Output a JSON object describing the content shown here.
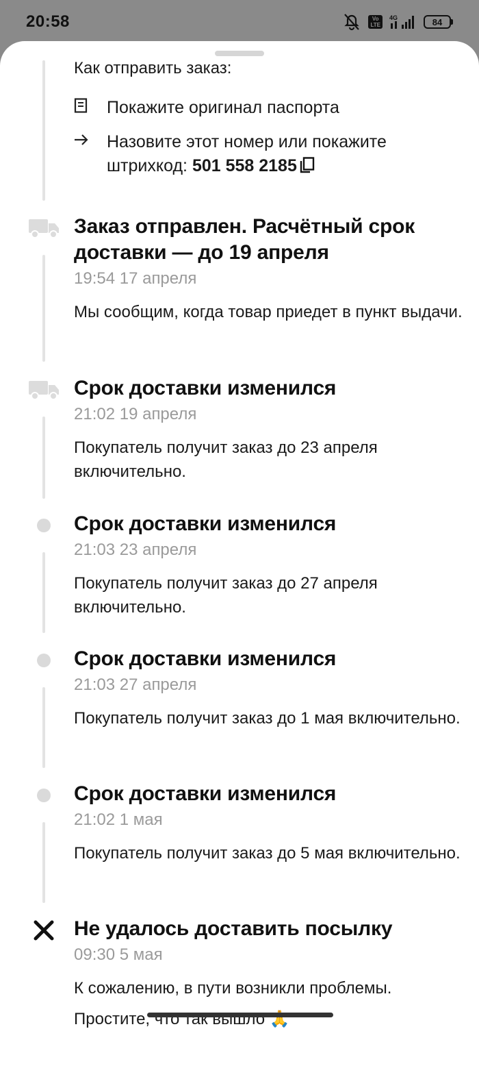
{
  "status_bar": {
    "time": "20:58",
    "battery": "84",
    "network": "4G",
    "volte": "Vo LTE"
  },
  "how_to_send": {
    "title": "Как отправить заказ:",
    "passport": "Покажите оригинал паспорта",
    "name_number_prefix": "Назовите этот номер или покажите штрихкод: ",
    "number": "501 558 2185"
  },
  "events": [
    {
      "title": "Заказ отправлен. Расчётный срок доставки — до 19 апреля",
      "time": "19:54 17 апреля",
      "message": "Мы сообщим, когда товар приедет в пункт выдачи.",
      "icon": "truck-icon"
    },
    {
      "title": "Срок доставки изменился",
      "time": "21:02 19 апреля",
      "message": "Покупатель получит заказ до 23 апреля включительно.",
      "icon": "truck-icon"
    },
    {
      "title": "Срок доставки изменился",
      "time": "21:03 23 апреля",
      "message": "Покупатель получит заказ до 27 апреля включительно.",
      "icon": "dot-icon"
    },
    {
      "title": "Срок доставки изменился",
      "time": "21:03 27 апреля",
      "message": "Покупатель получит заказ до 1 мая включительно.",
      "icon": "dot-icon"
    },
    {
      "title": "Срок доставки изменился",
      "time": "21:02 1 мая",
      "message": "Покупатель получит заказ до 5 мая включительно.",
      "icon": "dot-icon"
    },
    {
      "title": "Не удалось доставить посылку",
      "time": "09:30 5 мая",
      "message": "К сожалению, в пути возникли проблемы.",
      "message2": "Простите, что так вышло 🙏",
      "icon": "close-icon"
    }
  ],
  "colors": {
    "timeline_line": "#e3e3e3",
    "dot": "#dadada",
    "muted_text": "#9a9a9a"
  }
}
